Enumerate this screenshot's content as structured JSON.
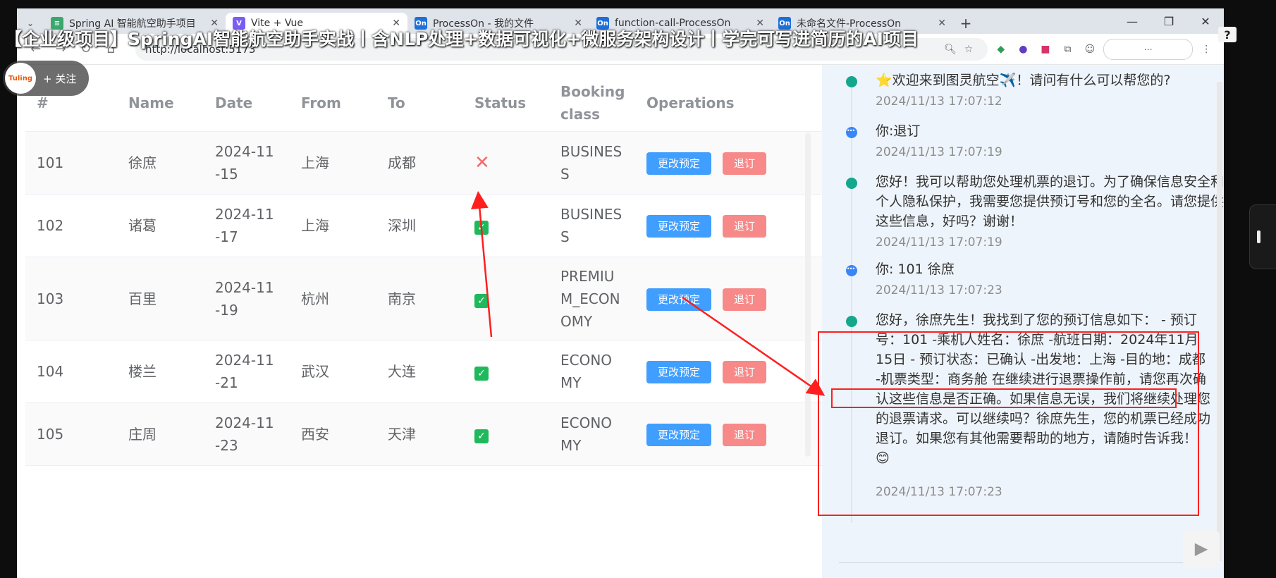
{
  "browser": {
    "tabs": [
      {
        "label": "Spring AI 智能航空助手项目",
        "fav_color": "#3aa76d",
        "fav_glyph": "≡",
        "active": false
      },
      {
        "label": "Vite + Vue",
        "fav_color": "#7b5cf5",
        "fav_glyph": "V",
        "active": true
      },
      {
        "label": "ProcessOn - 我的文件",
        "fav_color": "#1e6fd9",
        "fav_glyph": "On",
        "active": false
      },
      {
        "label": "function-call-ProcessOn",
        "fav_color": "#1e6fd9",
        "fav_glyph": "On",
        "active": false
      },
      {
        "label": "未命名文件-ProcessOn",
        "fav_color": "#1e6fd9",
        "fav_glyph": "On",
        "active": false
      }
    ],
    "url": "http://localhost:5173"
  },
  "overlay": {
    "video_title": "【企业级项目】SpringAI智能航空助手实战丨含NLP处理+数据可视化+微服务架构设计丨学完可写进简历的AI项目",
    "follow_label": "+ 关注",
    "avatar_text": "Tuling"
  },
  "table": {
    "headers": {
      "id": "#",
      "name": "Name",
      "date": "Date",
      "from": "From",
      "to": "To",
      "status": "Status",
      "booking_class": "Booking class",
      "operations": "Operations"
    },
    "change_label": "更改预定",
    "cancel_label": "退订",
    "rows": [
      {
        "id": "101",
        "name": "徐庶",
        "date": "2024-11-15",
        "from": "上海",
        "to": "成都",
        "status": "cancelled",
        "booking_class": "BUSINESS"
      },
      {
        "id": "102",
        "name": "诸葛",
        "date": "2024-11-17",
        "from": "上海",
        "to": "深圳",
        "status": "confirmed",
        "booking_class": "BUSINESS"
      },
      {
        "id": "103",
        "name": "百里",
        "date": "2024-11-19",
        "from": "杭州",
        "to": "南京",
        "status": "confirmed",
        "booking_class": "PREMIUM_ECONOMY"
      },
      {
        "id": "104",
        "name": "楼兰",
        "date": "2024-11-21",
        "from": "武汉",
        "to": "大连",
        "status": "confirmed",
        "booking_class": "ECONOMY"
      },
      {
        "id": "105",
        "name": "庄周",
        "date": "2024-11-23",
        "from": "西安",
        "to": "天津",
        "status": "confirmed",
        "booking_class": "ECONOMY"
      }
    ]
  },
  "chat": {
    "messages": [
      {
        "role": "ai",
        "text": "⭐欢迎来到图灵航空✈️！请问有什么可以帮您的?",
        "time": "2024/11/13 17:07:12"
      },
      {
        "role": "user",
        "text": "你:退订",
        "time": "2024/11/13 17:07:19"
      },
      {
        "role": "ai",
        "text": "您好！我可以帮助您处理机票的退订。为了确保信息安全和个人隐私保护，我需要您提供预订号和您的全名。请您提供这些信息，好吗？谢谢！",
        "time": "2024/11/13 17:07:19"
      },
      {
        "role": "user",
        "text": "你: 101 徐庶",
        "time": "2024/11/13 17:07:23"
      },
      {
        "role": "ai",
        "text": "您好，徐庶先生！我找到了您的预订信息如下： - 预订号：101 -乘机人姓名：徐庶 -航班日期：2024年11月15日 - 预订状态：已确认 -出发地：上海 -目的地：成都 -机票类型：商务舱 在继续进行退票操作前，请您再次确认这些信息是否正确。如果信息无误，我们将继续处理您的退票请求。可以继续吗？徐庶先生，您的机票已经成功退订。如果您有其他需要帮助的地方，请随时告诉我！ 😊",
        "time": "2024/11/13 17:07:23"
      }
    ]
  },
  "colors": {
    "primary": "#409eff",
    "danger": "#f78989",
    "annotation": "#ff1f1f",
    "status_ok": "#1fb95b",
    "status_cancel": "#f56c6c"
  }
}
